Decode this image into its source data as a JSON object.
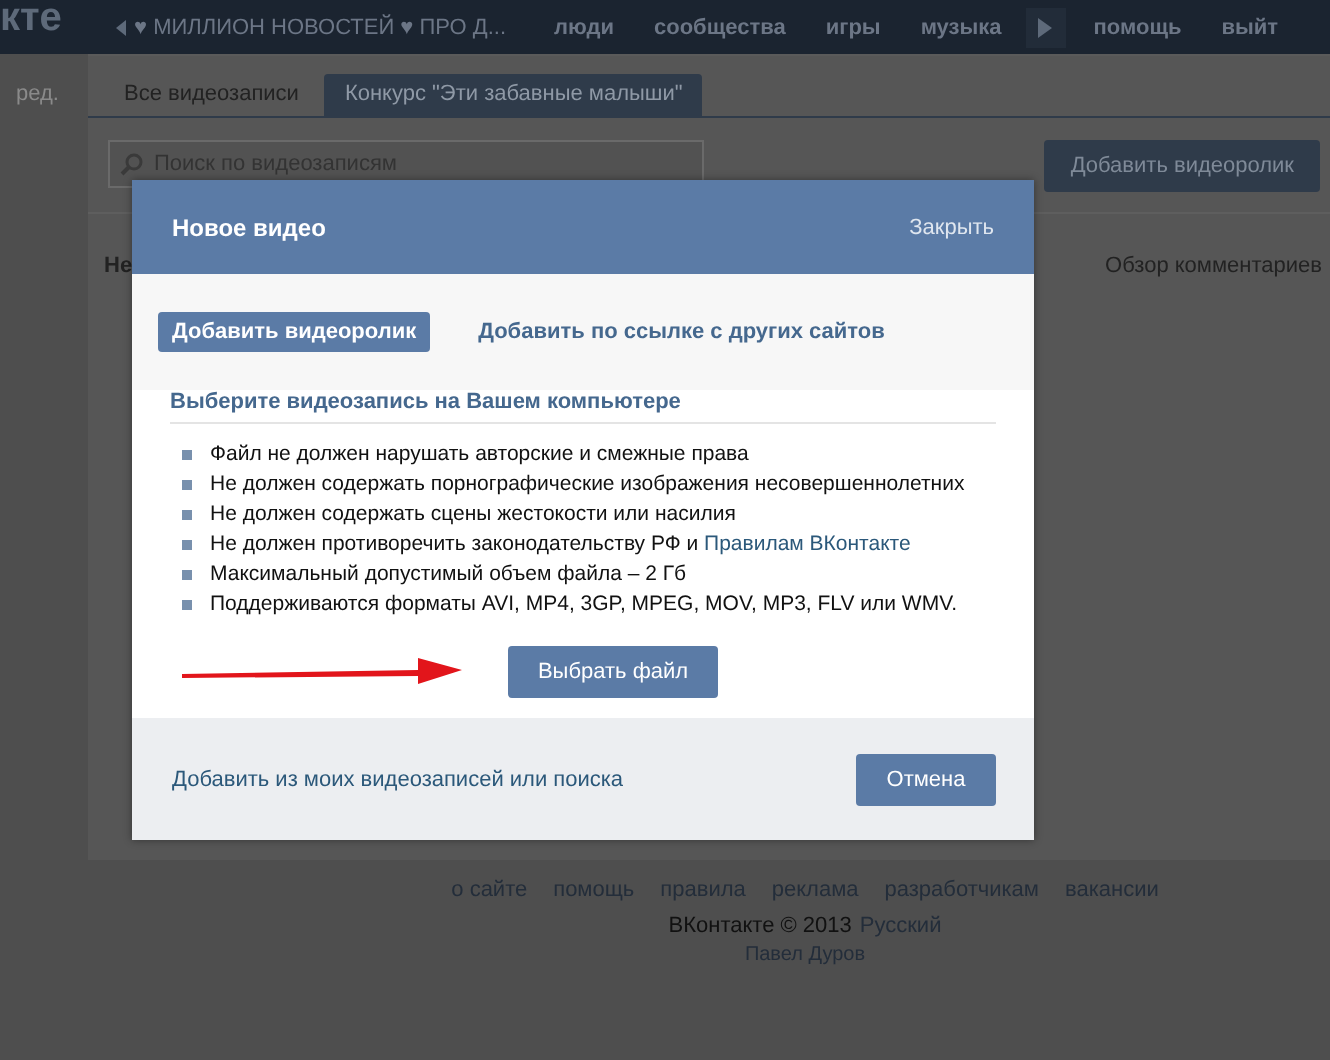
{
  "top_bar": {
    "logo": "кте",
    "now_playing": "♥ МИЛЛИОН НОВОСТЕЙ ♥ ПРО Д...",
    "links": [
      "люди",
      "сообщества",
      "игры",
      "музыка"
    ],
    "right_links": [
      "помощь",
      "выйт"
    ]
  },
  "sidebar": {
    "label": "ред."
  },
  "tabs": [
    {
      "label": "Все видеозаписи",
      "selected": false
    },
    {
      "label": "Конкурс \"Эти забавные малыши\"",
      "selected": true
    }
  ],
  "search": {
    "placeholder": "Поиск по видеозаписям"
  },
  "add_button": "Добавить видеоролик",
  "list_heading": "Не",
  "comments_link": "Обзор комментариев",
  "footer": {
    "links": [
      "о сайте",
      "помощь",
      "правила",
      "реклама",
      "разработчикам",
      "вакансии"
    ],
    "copyright": "ВКонтакте © 2013",
    "language": "Русский",
    "author": "Павел Дуров"
  },
  "dialog": {
    "title": "Новое видео",
    "close": "Закрыть",
    "modes": [
      {
        "label": "Добавить видеоролик",
        "selected": true
      },
      {
        "label": "Добавить по ссылке с других сайтов",
        "selected": false
      }
    ],
    "heading": "Выберите видеозапись на Вашем компьютере",
    "rules": [
      {
        "text": "Файл не должен нарушать авторские и смежные права"
      },
      {
        "text": "Не должен содержать порнографические изображения несовершеннолетних"
      },
      {
        "text": "Не должен содержать сцены жестокости или насилия"
      },
      {
        "text": "Не должен противоречить законодательству РФ и",
        "link": "Правилам ВКонтакте"
      },
      {
        "text": "Максимальный допустимый объем файла – 2 Гб"
      },
      {
        "text": "Поддерживаются форматы AVI, MP4, 3GP, MPEG, MOV, MP3, FLV или WMV."
      }
    ],
    "choose_button": "Выбрать файл",
    "footer_link": "Добавить из моих видеозаписей или поиска",
    "cancel_button": "Отмена"
  }
}
